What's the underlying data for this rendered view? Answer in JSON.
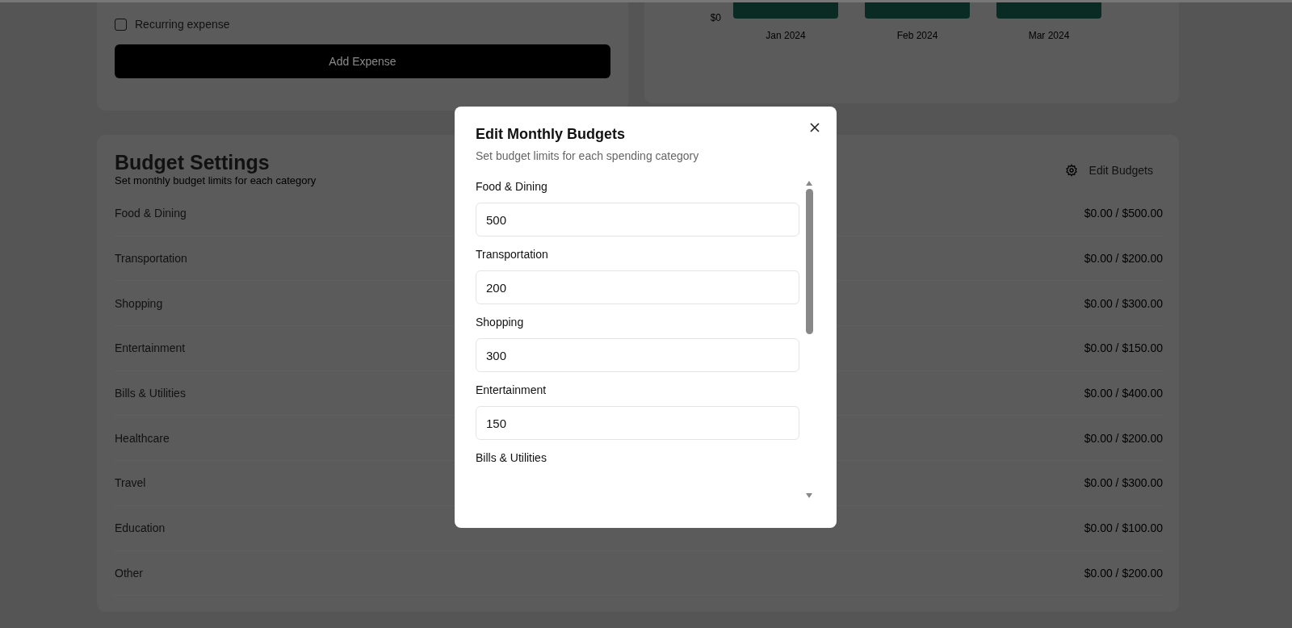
{
  "expense_form": {
    "recurring": {
      "label": "Recurring expense",
      "checked": false
    },
    "submit": "Add Expense"
  },
  "monthly_chart": {
    "y_tick": "$0",
    "months": [
      "Jan 2024",
      "Feb 2024",
      "Mar 2024"
    ]
  },
  "budget_settings": {
    "title": "Budget Settings",
    "subtitle": "Set monthly budget limits for each category",
    "edit_button": "Edit Budgets",
    "rows": [
      {
        "category": "Food & Dining",
        "amount": "$0.00 / $500.00"
      },
      {
        "category": "Transportation",
        "amount": "$0.00 / $200.00"
      },
      {
        "category": "Shopping",
        "amount": "$0.00 / $300.00"
      },
      {
        "category": "Entertainment",
        "amount": "$0.00 / $150.00"
      },
      {
        "category": "Bills & Utilities",
        "amount": "$0.00 / $400.00"
      },
      {
        "category": "Healthcare",
        "amount": "$0.00 / $200.00"
      },
      {
        "category": "Travel",
        "amount": "$0.00 / $300.00"
      },
      {
        "category": "Education",
        "amount": "$0.00 / $100.00"
      },
      {
        "category": "Other",
        "amount": "$0.00 / $200.00"
      }
    ]
  },
  "dialog": {
    "title": "Edit Monthly Budgets",
    "subtitle": "Set budget limits for each spending category",
    "fields": [
      {
        "label": "Food & Dining",
        "value": "500"
      },
      {
        "label": "Transportation",
        "value": "200"
      },
      {
        "label": "Shopping",
        "value": "300"
      },
      {
        "label": "Entertainment",
        "value": "150"
      },
      {
        "label": "Bills & Utilities"
      }
    ]
  }
}
